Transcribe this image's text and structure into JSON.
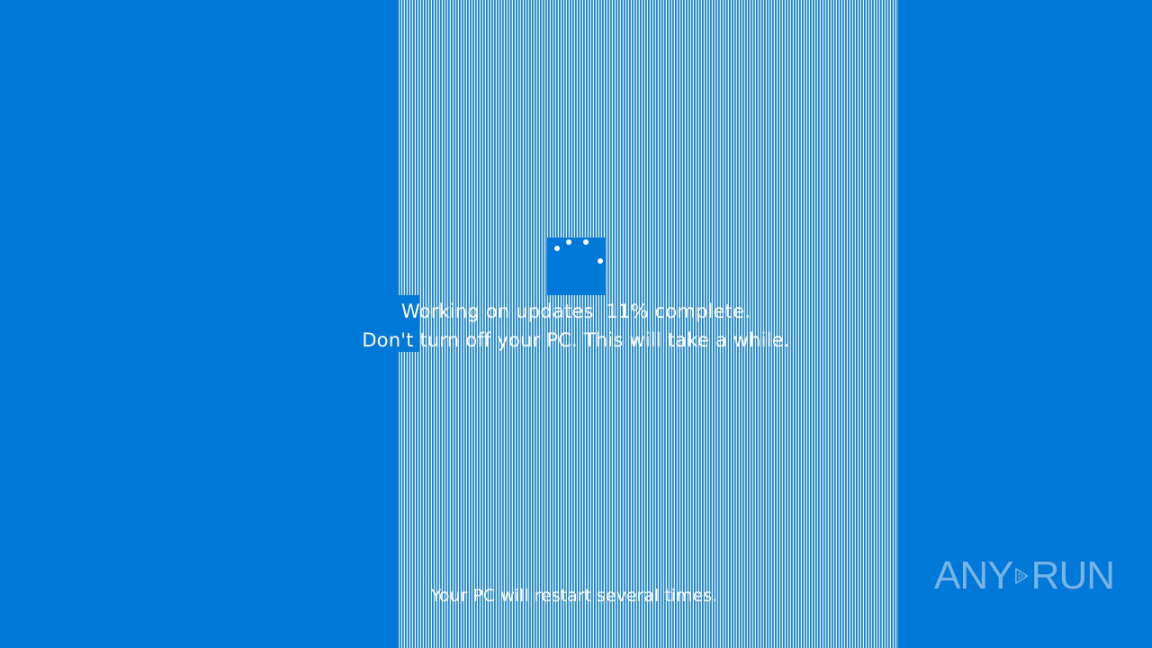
{
  "screen": {
    "background_color": "#0078d7",
    "text_color": "#ffffff"
  },
  "status": {
    "line1": "Working on updates  11% complete.",
    "line2": "Don't turn off your PC. This will take a while.",
    "progress_percent": 11
  },
  "footer": {
    "restart_notice": "Your PC will restart several times."
  },
  "watermark": {
    "text_left": "ANY",
    "text_right": "RUN",
    "icon": "play-triangle-icon"
  },
  "spinner": {
    "icon": "loading-dots-icon"
  }
}
